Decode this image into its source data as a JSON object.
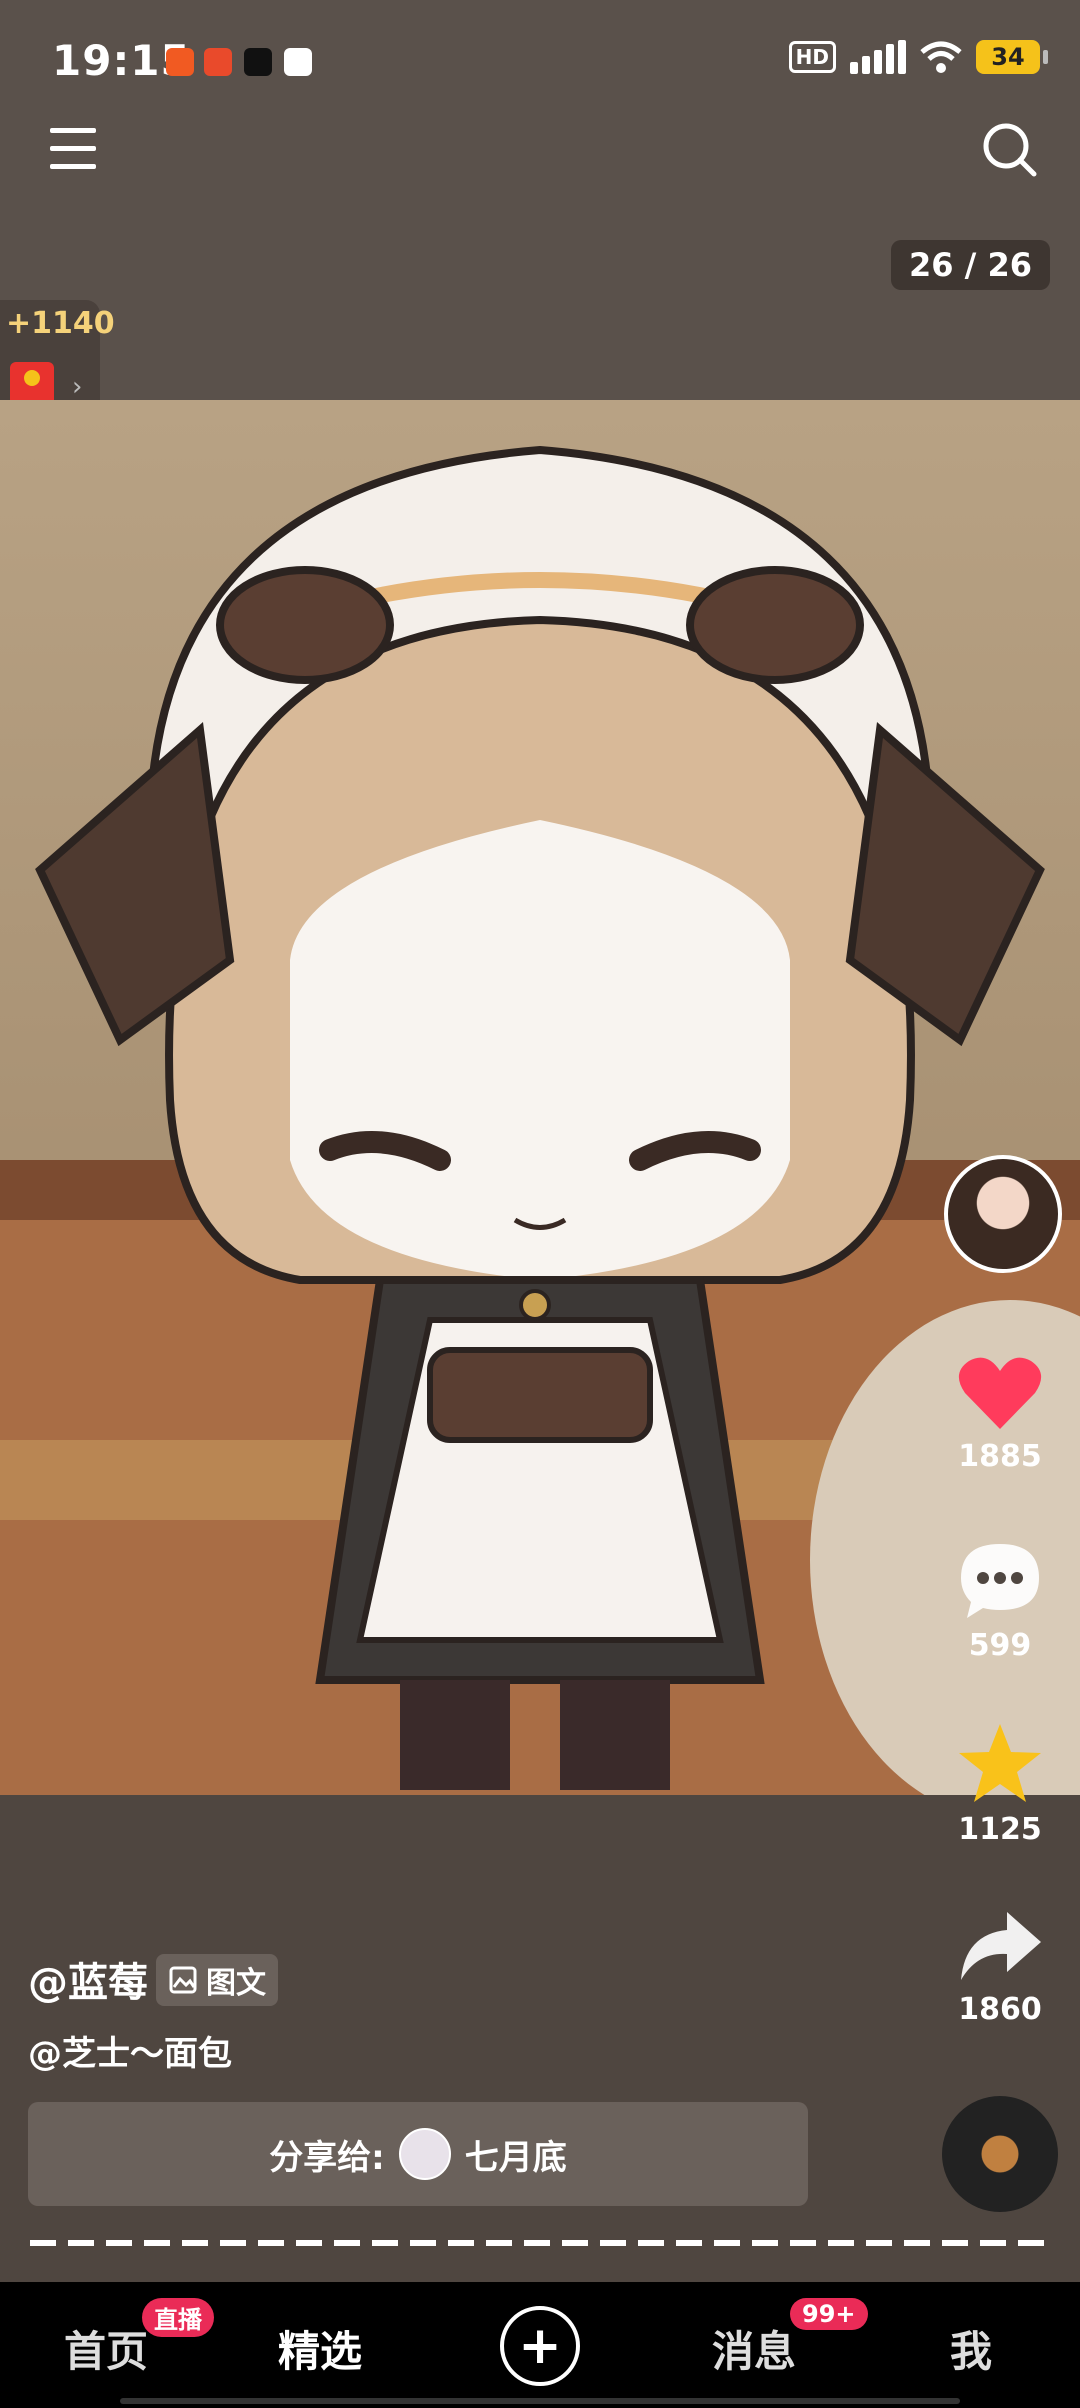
{
  "status_bar": {
    "time": "19:15",
    "hd": "HD",
    "battery": "34"
  },
  "header": {
    "page_counter": "26 / 26"
  },
  "reward": {
    "amount": "+1140"
  },
  "actions": {
    "likes": "1885",
    "comments": "599",
    "favorites": "1125",
    "shares": "1860",
    "like_color": "#ff3b5c",
    "star_color": "#f9c21a"
  },
  "post": {
    "author": "@蓝莓",
    "type_tag": "图文",
    "mention": "@芝士～面包",
    "share_label": "分享给:",
    "share_target": "七月底"
  },
  "nav": {
    "home": "首页",
    "home_badge": "直播",
    "featured": "精选",
    "messages": "消息",
    "messages_badge": "99+",
    "me": "我"
  }
}
